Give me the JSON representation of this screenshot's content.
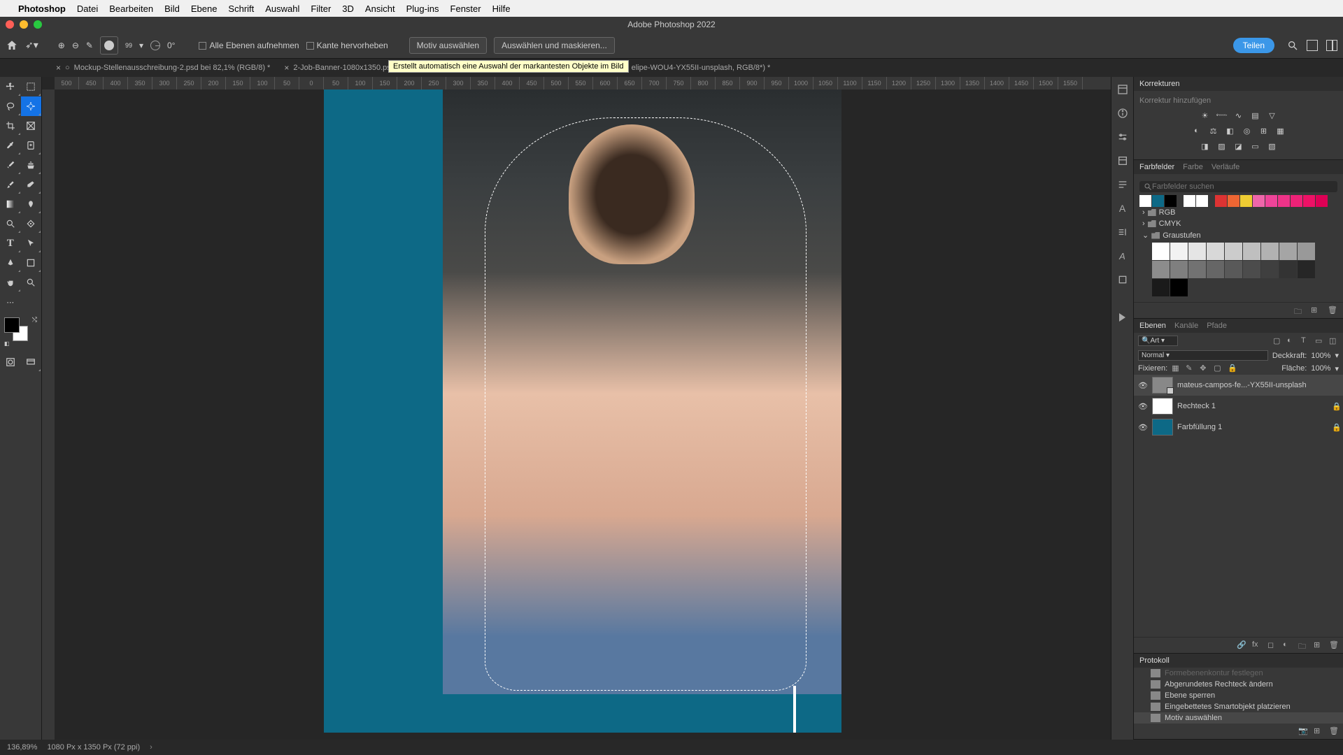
{
  "macos": {
    "app": "Photoshop",
    "menus": [
      "Datei",
      "Bearbeiten",
      "Bild",
      "Ebene",
      "Schrift",
      "Auswahl",
      "Filter",
      "3D",
      "Ansicht",
      "Plug-ins",
      "Fenster",
      "Hilfe"
    ]
  },
  "titlebar": {
    "title": "Adobe Photoshop 2022"
  },
  "options": {
    "brush_size": "99",
    "angle": "0°",
    "chk1": "Alle Ebenen aufnehmen",
    "chk2": "Kante hervorheben",
    "btn_subject": "Motiv auswählen",
    "btn_selectmask": "Auswählen und maskieren...",
    "share": "Teilen",
    "tooltip": "Erstellt automatisch eine Auswahl der markantesten Objekte im Bild"
  },
  "tabs": {
    "t1": "Mockup-Stellenausschreibung-2.psd bei 82,1% (RGB/8) *",
    "t2": "2-Job-Banner-1080x1350.psd bei",
    "t3_tail": "elipe-WOU4-YX55II-unsplash, RGB/8*) *"
  },
  "ruler_marks": [
    "500",
    "450",
    "400",
    "350",
    "300",
    "250",
    "200",
    "150",
    "100",
    "50",
    "0",
    "50",
    "100",
    "150",
    "200",
    "250",
    "300",
    "350",
    "400",
    "450",
    "500",
    "550",
    "600",
    "650",
    "700",
    "750",
    "800",
    "850",
    "900",
    "950",
    "1000",
    "1050",
    "1100",
    "1150",
    "1200",
    "1250",
    "1300",
    "1350",
    "1400",
    "1450",
    "1500",
    "1550"
  ],
  "adjustments": {
    "title": "Korrekturen",
    "add": "Korrektur hinzufügen"
  },
  "swatches": {
    "tabs": [
      "Farbfelder",
      "Farbe",
      "Verläufe"
    ],
    "search_ph": "Farbfelder suchen",
    "row_colors": [
      "#ffffff",
      "#0d6986",
      "#000000",
      "#ffffff",
      "#ffffff",
      "",
      "#dd3333",
      "#ee6633",
      "#eecc33",
      "#ee66aa",
      "#ee4499",
      "#ee3388",
      "#ee2277",
      "#ee1166",
      "#dd0055"
    ],
    "folders": [
      "RGB",
      "CMYK",
      "Graustufen"
    ],
    "grays": [
      "#ffffff",
      "#f2f2f2",
      "#e5e5e5",
      "#d8d8d8",
      "#cccccc",
      "#bfbfbf",
      "#b2b2b2",
      "#a5a5a5",
      "#999999",
      "#8c8c8c",
      "#7f7f7f",
      "#727272",
      "#666666",
      "#595959",
      "#4c4c4c",
      "#3f3f3f",
      "#333333",
      "#262626",
      "#1a1a1a",
      "#000000"
    ]
  },
  "layers": {
    "tabs": [
      "Ebenen",
      "Kanäle",
      "Pfade"
    ],
    "kind": "Art",
    "blend": "Normal",
    "opacity_lbl": "Deckkraft:",
    "opacity": "100%",
    "lock_lbl": "Fixieren:",
    "fill_lbl": "Fläche:",
    "fill": "100%",
    "items": [
      {
        "name": "mateus-campos-fe...-YX55II-unsplash",
        "type": "smart",
        "selected": true,
        "locked": false
      },
      {
        "name": "Rechteck 1",
        "type": "rect",
        "selected": false,
        "locked": true
      },
      {
        "name": "Farbfüllung 1",
        "type": "fill",
        "selected": false,
        "locked": true
      }
    ]
  },
  "history": {
    "title": "Protokoll",
    "items": [
      "Formebenenkontur festlegen",
      "Abgerundetes Rechteck ändern",
      "Ebene sperren",
      "Eingebettetes Smartobjekt platzieren",
      "Motiv auswählen"
    ]
  },
  "status": {
    "zoom": "136,89%",
    "dims": "1080 Px x 1350 Px (72 ppi)"
  }
}
